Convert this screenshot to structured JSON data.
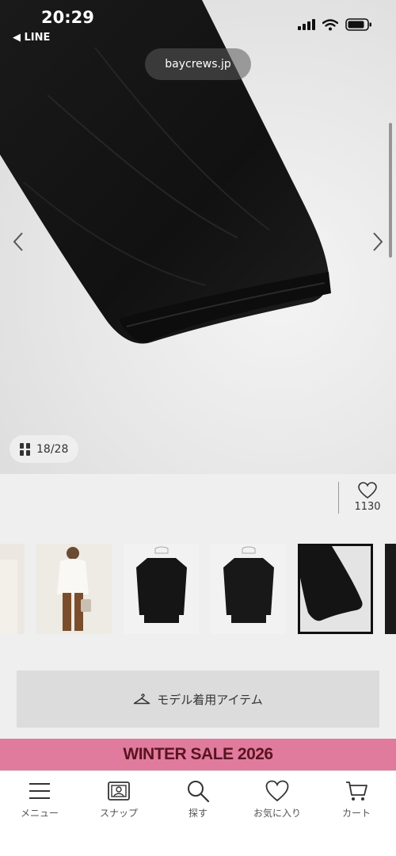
{
  "status_bar": {
    "time": "20:29",
    "back_app": "◀ LINE"
  },
  "browser": {
    "url": "baycrews.jp"
  },
  "gallery": {
    "counter": "18/28"
  },
  "product": {
    "like_count": "1130"
  },
  "model_item_button": {
    "label": "モデル着用アイテム",
    "icon": "hanger-icon"
  },
  "banner": {
    "text": "WINTER SALE 2026",
    "background": "#e07b9e",
    "text_color": "#5a1420"
  },
  "bottom_nav": {
    "items": [
      {
        "label": "メニュー",
        "icon": "hamburger-menu-icon"
      },
      {
        "label": "スナップ",
        "icon": "snap-photo-icon"
      },
      {
        "label": "探す",
        "icon": "search-icon"
      },
      {
        "label": "お気に入り",
        "icon": "heart-icon"
      },
      {
        "label": "カート",
        "icon": "cart-icon"
      }
    ]
  }
}
